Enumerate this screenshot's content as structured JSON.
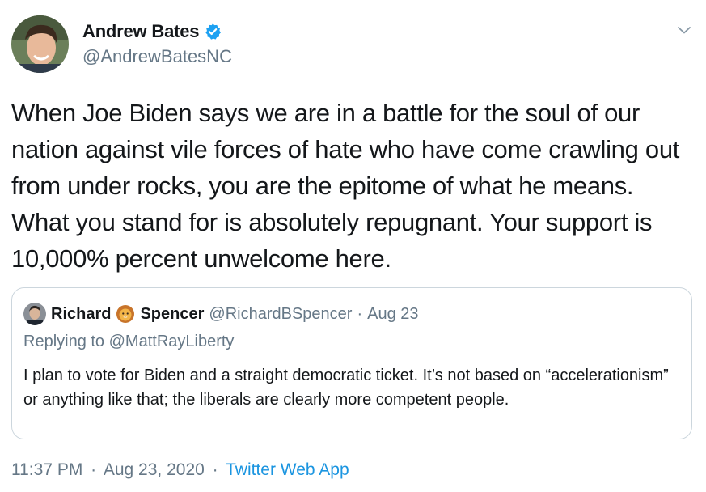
{
  "author": {
    "display_name": "Andrew Bates",
    "handle": "@AndrewBatesNC",
    "verified": true
  },
  "tweet": {
    "text": "When Joe Biden says we are in a battle for the soul of our nation against vile forces of hate who have come crawling out from under rocks, you are the epitome of what he means. What you stand for is absolutely repugnant. Your support is 10,000% percent unwelcome here."
  },
  "quoted_tweet": {
    "name_first": "Richard",
    "name_last": "Spencer",
    "handle": "@RichardBSpencer",
    "separator": "·",
    "date": "Aug 23",
    "replying_to": "Replying to @MattRayLiberty",
    "text": "I plan to vote for Biden and a straight democratic ticket. It’s not based on “accelerationism” or anything like that; the liberals are clearly more competent people."
  },
  "footer": {
    "time": "11:37 PM",
    "date": "Aug 23, 2020",
    "separator": "·",
    "source": "Twitter Web App"
  },
  "icons": {
    "verified": "verified-badge-icon",
    "caret": "chevron-down-icon",
    "lion": "lion-emoji-icon"
  },
  "colors": {
    "text_primary": "#14171a",
    "text_secondary": "#657786",
    "link": "#1b95e0",
    "verified_blue": "#1da1f2",
    "border": "#ccd6dd"
  }
}
